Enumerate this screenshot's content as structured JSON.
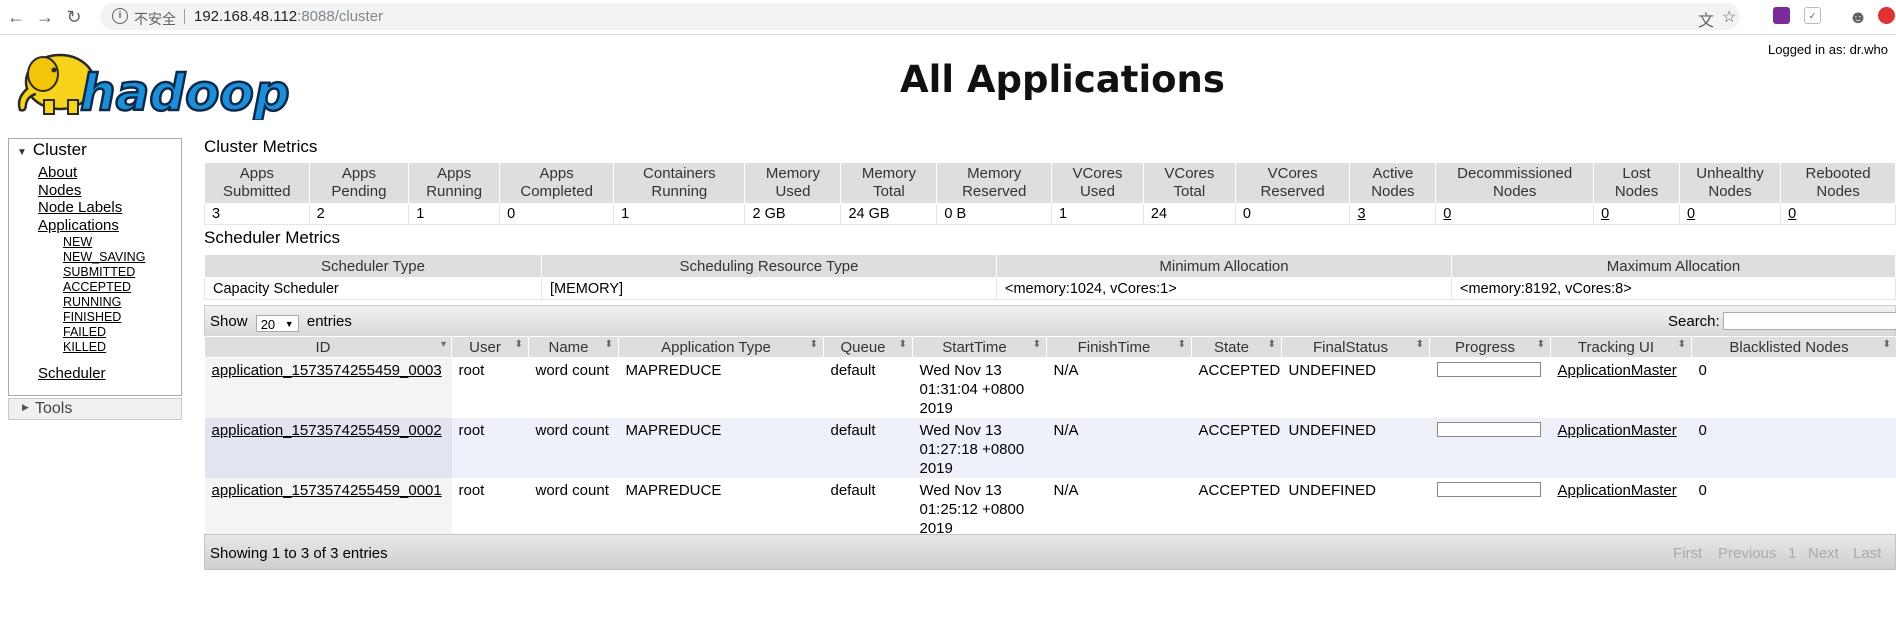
{
  "browser": {
    "insecure_label": "不安全",
    "url_host": "192.168.48.112",
    "url_rest": ":8088/cluster"
  },
  "header": {
    "logo_text": "hadoop",
    "title": "All Applications",
    "logged_in": "Logged in as: dr.who"
  },
  "nav": {
    "cluster_label": "Cluster",
    "links": [
      "About",
      "Nodes",
      "Node Labels",
      "Applications"
    ],
    "app_states": [
      "NEW",
      "NEW_SAVING",
      "SUBMITTED",
      "ACCEPTED",
      "RUNNING",
      "FINISHED",
      "FAILED",
      "KILLED"
    ],
    "scheduler_label": "Scheduler",
    "tools_label": "Tools"
  },
  "cluster_metrics": {
    "title": "Cluster Metrics",
    "headers": [
      [
        "Apps",
        "Submitted"
      ],
      [
        "Apps",
        "Pending"
      ],
      [
        "Apps",
        "Running"
      ],
      [
        "Apps",
        "Completed"
      ],
      [
        "Containers",
        "Running"
      ],
      [
        "Memory",
        "Used"
      ],
      [
        "Memory",
        "Total"
      ],
      [
        "Memory",
        "Reserved"
      ],
      [
        "VCores",
        "Used"
      ],
      [
        "VCores",
        "Total"
      ],
      [
        "VCores",
        "Reserved"
      ],
      [
        "Active",
        "Nodes"
      ],
      [
        "Decommissioned",
        "Nodes"
      ],
      [
        "Lost",
        "Nodes"
      ],
      [
        "Unhealthy",
        "Nodes"
      ],
      [
        "Rebooted",
        "Nodes"
      ]
    ],
    "values": [
      "3",
      "2",
      "1",
      "0",
      "1",
      "2 GB",
      "24 GB",
      "0 B",
      "1",
      "24",
      "0",
      "3",
      "0",
      "0",
      "0",
      "0"
    ]
  },
  "scheduler_metrics": {
    "title": "Scheduler Metrics",
    "headers": [
      "Scheduler Type",
      "Scheduling Resource Type",
      "Minimum Allocation",
      "Maximum Allocation"
    ],
    "values": [
      "Capacity Scheduler",
      "[MEMORY]",
      "<memory:1024, vCores:1>",
      "<memory:8192, vCores:8>"
    ]
  },
  "apps_table": {
    "show_label": "Show",
    "show_value": "20",
    "entries_label": "entries",
    "search_label": "Search:",
    "columns": [
      "ID",
      "User",
      "Name",
      "Application Type",
      "Queue",
      "StartTime",
      "FinishTime",
      "State",
      "FinalStatus",
      "Progress",
      "Tracking UI",
      "Blacklisted Nodes"
    ],
    "rows": [
      {
        "id": "application_1573574255459_0003",
        "user": "root",
        "name": "word count",
        "type": "MAPREDUCE",
        "queue": "default",
        "start": "Wed Nov 13 01:31:04 +0800 2019",
        "finish": "N/A",
        "state": "ACCEPTED",
        "final": "UNDEFINED",
        "progress": 0,
        "tracking": "ApplicationMaster",
        "blacklisted": "0"
      },
      {
        "id": "application_1573574255459_0002",
        "user": "root",
        "name": "word count",
        "type": "MAPREDUCE",
        "queue": "default",
        "start": "Wed Nov 13 01:27:18 +0800 2019",
        "finish": "N/A",
        "state": "ACCEPTED",
        "final": "UNDEFINED",
        "progress": 0,
        "tracking": "ApplicationMaster",
        "blacklisted": "0"
      },
      {
        "id": "application_1573574255459_0001",
        "user": "root",
        "name": "word count",
        "type": "MAPREDUCE",
        "queue": "default",
        "start": "Wed Nov 13 01:25:12 +0800 2019",
        "finish": "N/A",
        "state": "ACCEPTED",
        "final": "UNDEFINED",
        "progress": 0,
        "tracking": "ApplicationMaster",
        "blacklisted": "0"
      }
    ],
    "showing_text": "Showing 1 to 3 of 3 entries",
    "pager": {
      "first": "First",
      "previous": "Previous",
      "page": "1",
      "next": "Next",
      "last": "Last"
    }
  }
}
